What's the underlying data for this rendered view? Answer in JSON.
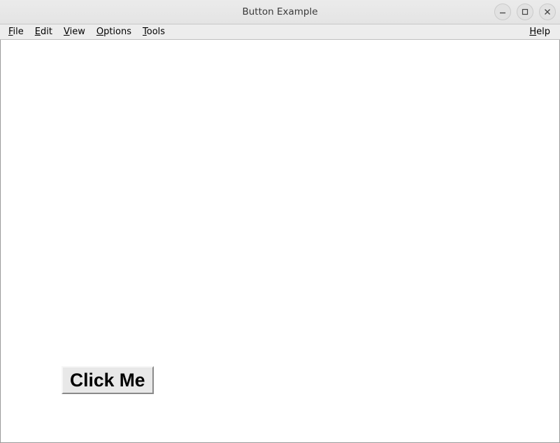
{
  "window": {
    "title": "Button Example"
  },
  "menubar": {
    "items": [
      {
        "accel": "F",
        "rest": "ile"
      },
      {
        "accel": "E",
        "rest": "dit"
      },
      {
        "accel": "V",
        "rest": "iew"
      },
      {
        "accel": "O",
        "rest": "ptions"
      },
      {
        "accel": "T",
        "rest": "ools"
      }
    ],
    "help": {
      "accel": "H",
      "rest": "elp"
    }
  },
  "button": {
    "label": "Click Me"
  }
}
